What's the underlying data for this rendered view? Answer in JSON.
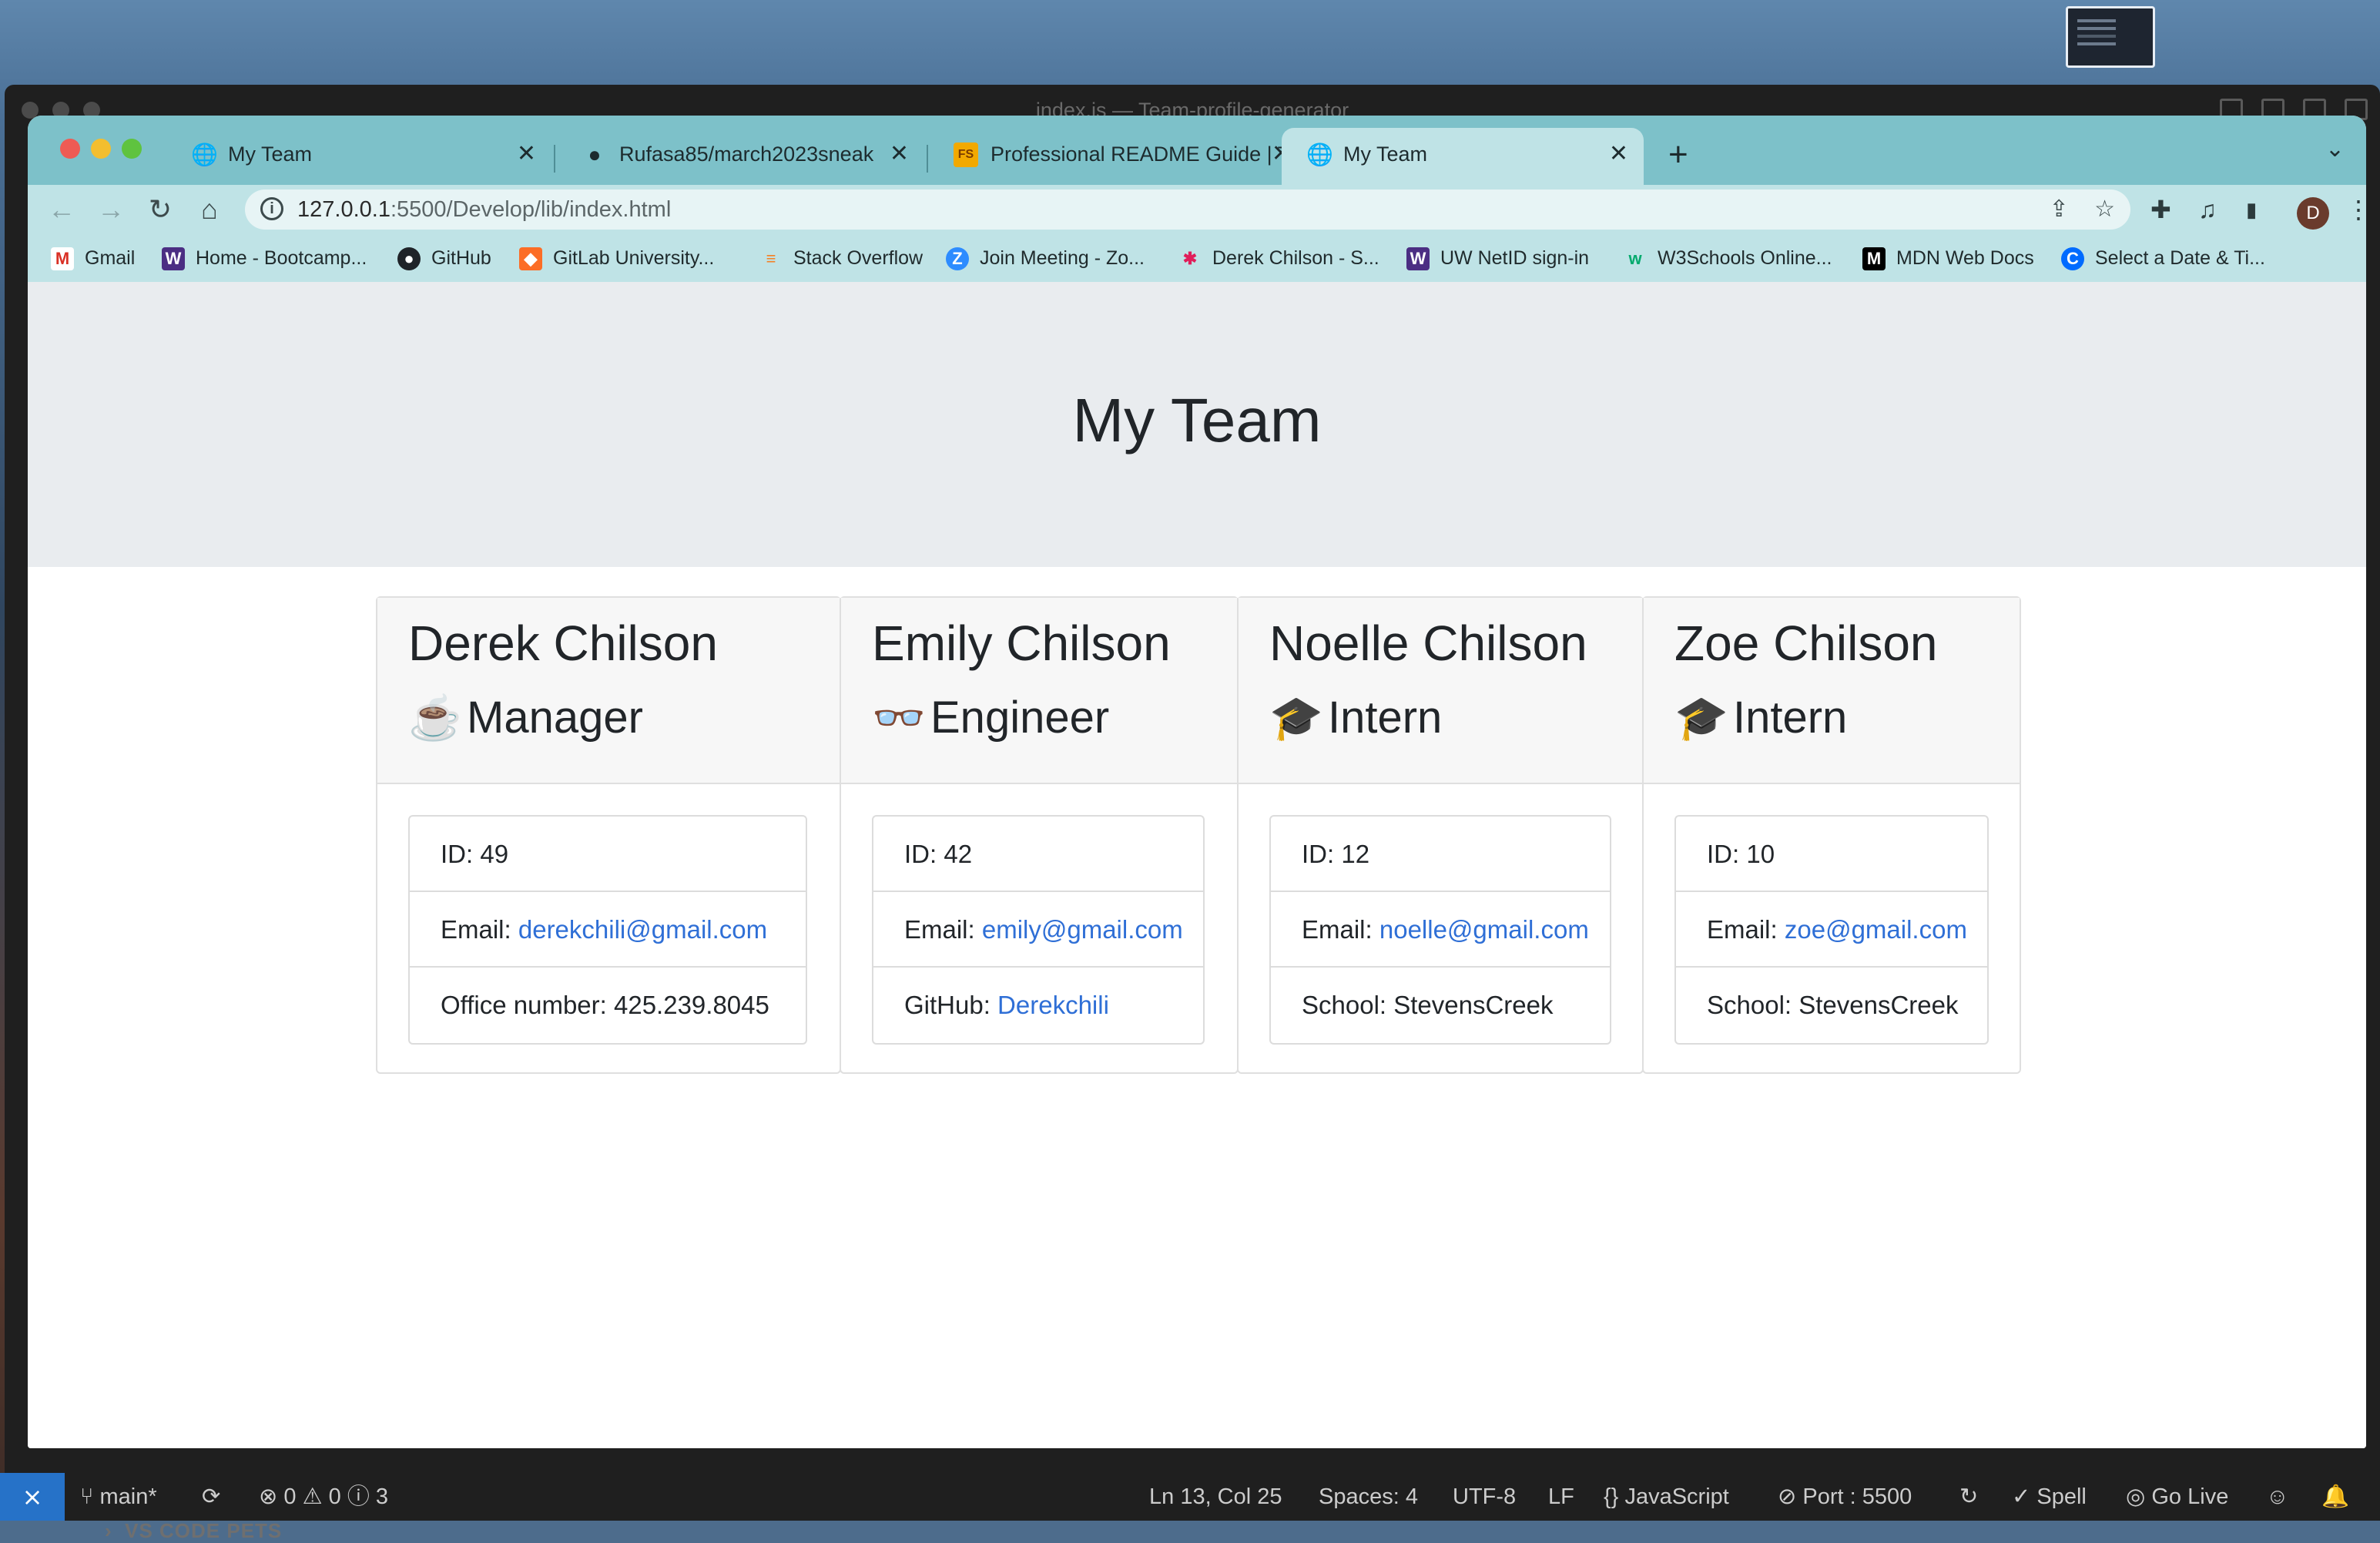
{
  "vscode": {
    "window_title": "index.js — Team-profile-generator",
    "explorer_section": "VS CODE PETS",
    "status": {
      "remote_icon": "remote-icon",
      "branch": "main*",
      "errors": "0",
      "warnings": "0",
      "info": "3",
      "cursor": "Ln 13, Col 25",
      "spaces": "Spaces: 4",
      "encoding": "UTF-8",
      "eol": "LF",
      "language": "JavaScript",
      "port": "Port : 5500",
      "spell": "Spell",
      "golive": "Go Live"
    }
  },
  "browser": {
    "tabs": [
      {
        "title": "My Team",
        "icon": "globe-icon"
      },
      {
        "title": "Rufasa85/march2023sneak",
        "icon": "github-icon"
      },
      {
        "title": "Professional README Guide | T",
        "icon": "fs-icon"
      },
      {
        "title": "My Team",
        "icon": "globe-icon"
      }
    ],
    "url_host": "127.0.0.1",
    "url_path": ":5500/Develop/lib/index.html",
    "profile_initial": "D",
    "bookmarks": [
      {
        "label": "Gmail",
        "icon": "gmail-icon"
      },
      {
        "label": "Home - Bootcamp...",
        "icon": "w-icon"
      },
      {
        "label": "GitHub",
        "icon": "github-icon"
      },
      {
        "label": "GitLab University...",
        "icon": "gitlab-icon"
      },
      {
        "label": "Stack Overflow",
        "icon": "stackoverflow-icon"
      },
      {
        "label": "Join Meeting - Zo...",
        "icon": "zoom-icon"
      },
      {
        "label": "Derek Chilson - S...",
        "icon": "slack-icon"
      },
      {
        "label": "UW NetID sign-in",
        "icon": "w-icon"
      },
      {
        "label": "W3Schools Online...",
        "icon": "w3schools-icon"
      },
      {
        "label": "MDN Web Docs",
        "icon": "mdn-icon"
      },
      {
        "label": "Select a Date & Ti...",
        "icon": "calendly-icon"
      }
    ]
  },
  "page": {
    "title": "My Team",
    "team": [
      {
        "name": "Derek Chilson",
        "role": "Manager",
        "role_icon": "coffee-icon",
        "id": "ID: 49",
        "email_label": "Email:",
        "email": "derekchili@gmail.com",
        "extra_label": "Office number: 425.239.8045",
        "extra_link": ""
      },
      {
        "name": "Emily Chilson",
        "role": "Engineer",
        "role_icon": "glasses-icon",
        "id": "ID: 42",
        "email_label": "Email:",
        "email": "emily@gmail.com",
        "extra_label": "GitHub:",
        "extra_link": "Derekchili"
      },
      {
        "name": "Noelle Chilson",
        "role": "Intern",
        "role_icon": "graduate-icon",
        "id": "ID: 12",
        "email_label": "Email:",
        "email": "noelle@gmail.com",
        "extra_label": "School: StevensCreek",
        "extra_link": ""
      },
      {
        "name": "Zoe Chilson",
        "role": "Intern",
        "role_icon": "graduate-icon",
        "id": "ID: 10",
        "email_label": "Email:",
        "email": "zoe@gmail.com",
        "extra_label": "School: StevensCreek",
        "extra_link": ""
      }
    ]
  },
  "colors": {
    "tabbar": "#7dc1c9",
    "toolbar": "#bfe3e6",
    "jumbotron": "#e9ecef",
    "link": "#2f6fd6",
    "status_remote": "#2672c8"
  }
}
